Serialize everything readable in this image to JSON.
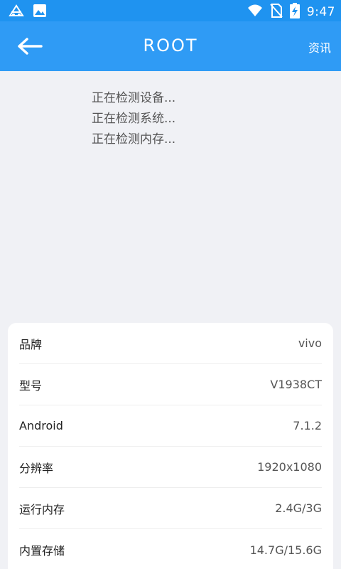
{
  "status_bar": {
    "time": "9:47",
    "icons": [
      "notification-icon",
      "image-icon",
      "wifi-icon",
      "no-sim-icon",
      "battery-charging-icon"
    ]
  },
  "app_bar": {
    "title": "ROOT",
    "back_icon": "arrow-left-icon",
    "news_label": "资讯"
  },
  "detect_lines": [
    "正在检测设备...",
    "正在检测系统...",
    "正在检测内存..."
  ],
  "info_rows": [
    {
      "label": "品牌",
      "value": "vivo"
    },
    {
      "label": "型号",
      "value": "V1938CT"
    },
    {
      "label": "Android",
      "value": "7.1.2"
    },
    {
      "label": "分辨率",
      "value": "1920x1080"
    },
    {
      "label": "运行内存",
      "value": "2.4G/3G"
    },
    {
      "label": "内置存储",
      "value": "14.7G/15.6G"
    }
  ],
  "colors": {
    "status_bar": "#1f93f0",
    "app_bar": "#2f9bf5",
    "background": "#f0f1f5"
  }
}
